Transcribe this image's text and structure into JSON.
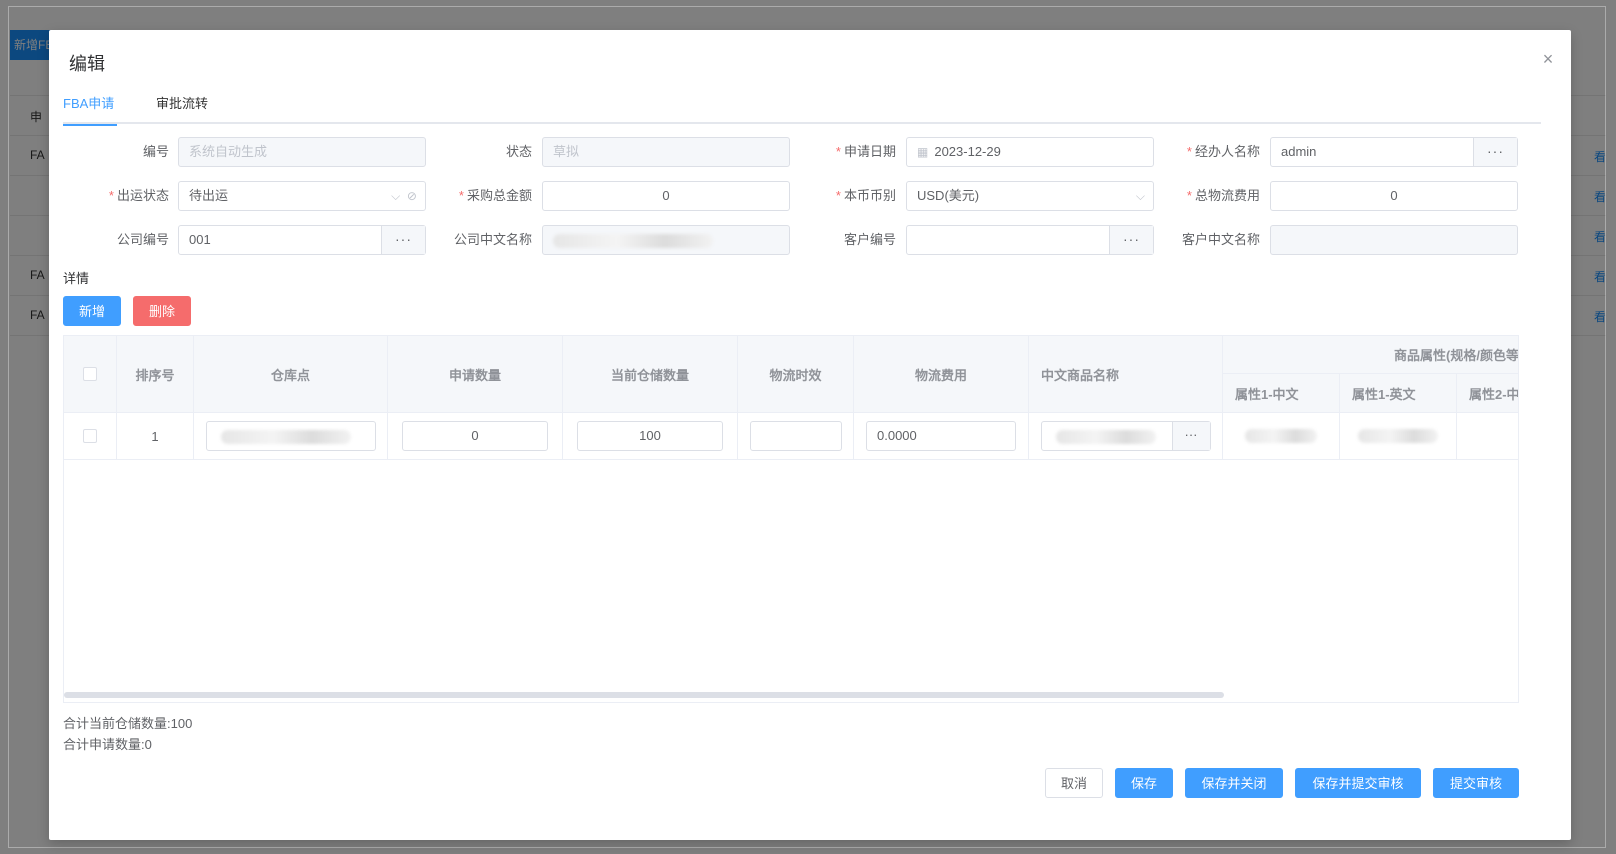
{
  "background": {
    "add_button": "新增FBA",
    "rows": [
      "申",
      "FA",
      "FA",
      "FA"
    ],
    "right_links": [
      "看",
      "看",
      "看",
      "看",
      "看"
    ]
  },
  "modal": {
    "title": "编辑",
    "close": "×",
    "tabs": [
      {
        "label": "FBA申请"
      },
      {
        "label": "审批流转"
      }
    ]
  },
  "form": {
    "code": {
      "label": "编号",
      "placeholder": "系统自动生成"
    },
    "status": {
      "label": "状态",
      "placeholder": "草拟"
    },
    "apply_date": {
      "label": "申请日期",
      "value": "2023-12-29"
    },
    "handler": {
      "label": "经办人名称",
      "value": "admin"
    },
    "ship_status": {
      "label": "出运状态",
      "value": "待出运"
    },
    "purchase_total": {
      "label": "采购总金额",
      "value": "0"
    },
    "currency": {
      "label": "本币币别",
      "value": "USD(美元)"
    },
    "logistics_total": {
      "label": "总物流费用",
      "value": "0"
    },
    "company_code": {
      "label": "公司编号",
      "value": "001"
    },
    "company_name": {
      "label": "公司中文名称"
    },
    "customer_code": {
      "label": "客户编号",
      "value": ""
    },
    "customer_name": {
      "label": "客户中文名称"
    },
    "more_icon": "···"
  },
  "details": {
    "section_label": "详情",
    "add_label": "新增",
    "delete_label": "删除"
  },
  "table": {
    "columns": {
      "seq": "排序号",
      "warehouse": "仓库点",
      "apply_qty": "申请数量",
      "stock_qty": "当前仓储数量",
      "logistics_time": "物流时效",
      "logistics_fee": "物流费用",
      "product_name": "中文商品名称",
      "attr_group": "商品属性(规格/颜色等",
      "attr1_cn": "属性1-中文",
      "attr1_en": "属性1-英文",
      "attr2_cn": "属性2-中"
    },
    "rows": [
      {
        "seq": "1",
        "apply_qty": "0",
        "stock_qty": "100",
        "logistics_time": "",
        "logistics_fee": "0.0000"
      }
    ]
  },
  "summary": {
    "stock_total": "合计当前仓储数量:100",
    "apply_total": "合计申请数量:0"
  },
  "footer": {
    "cancel": "取消",
    "save": "保存",
    "save_close": "保存并关闭",
    "save_submit": "保存并提交审核",
    "submit": "提交审核"
  }
}
